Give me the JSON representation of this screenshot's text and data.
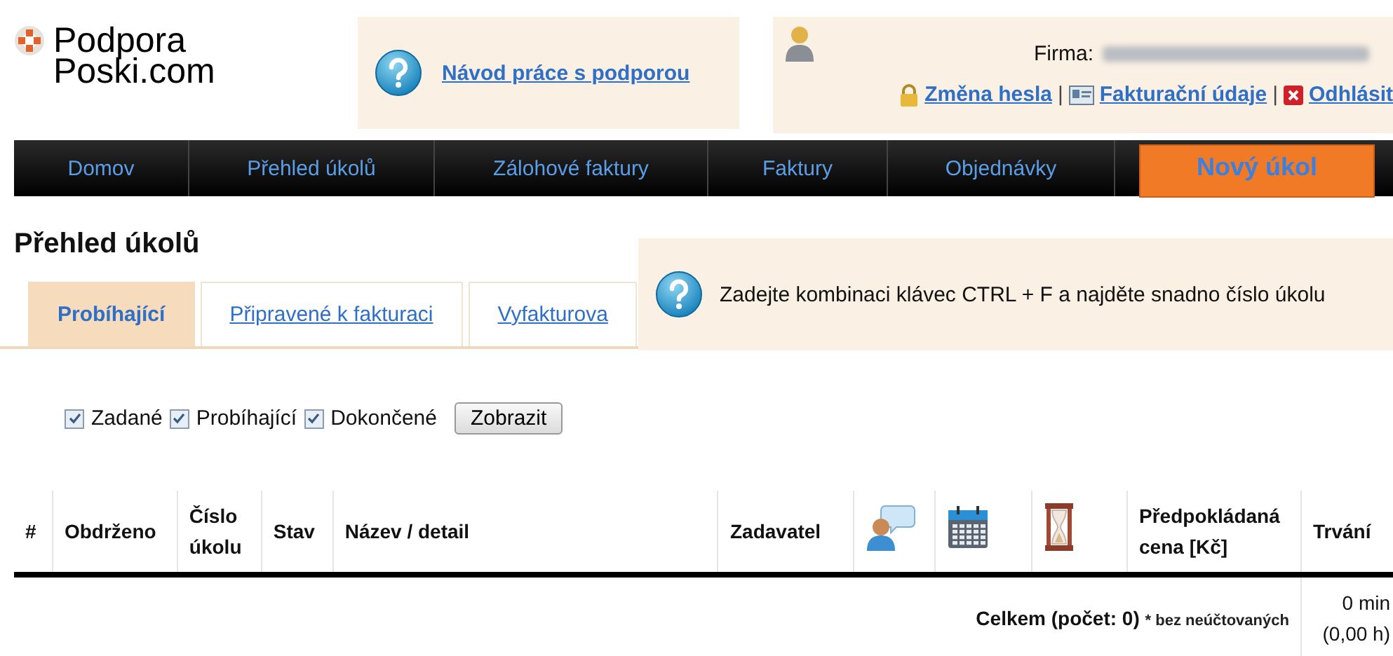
{
  "logo": {
    "line1": "Podpora",
    "line2": "Poski.com"
  },
  "help_box": {
    "link": "Návod práce s podporou"
  },
  "user_box": {
    "company_label": "Firma:",
    "links": [
      {
        "kind": "lock",
        "label": "Změna hesla"
      },
      {
        "kind": "card",
        "label": "Fakturační údaje"
      },
      {
        "kind": "close",
        "label": "Odhlásit"
      }
    ],
    "separator": "|"
  },
  "nav": [
    {
      "label": "Domov"
    },
    {
      "label": "Přehled úkolů"
    },
    {
      "label": "Zálohové faktury"
    },
    {
      "label": "Faktury"
    },
    {
      "label": "Objednávky"
    }
  ],
  "new_task_button": "Nový úkol",
  "page_title": "Přehled úkolů",
  "hint": "Zadejte kombinaci klávec CTRL + F a najděte snadno číslo úkolu",
  "tabs": [
    {
      "label": "Probíhající",
      "selected": true
    },
    {
      "label": "Připravené k fakturaci",
      "selected": false
    },
    {
      "label": "Vyfakturova",
      "selected": false
    }
  ],
  "filters": [
    {
      "label": "Zadané",
      "checked": true
    },
    {
      "label": "Probíhající",
      "checked": true
    },
    {
      "label": "Dokončené",
      "checked": true
    }
  ],
  "show_button": "Zobrazit",
  "table": {
    "columns": [
      {
        "kind": "text",
        "label": "#"
      },
      {
        "kind": "text",
        "label": "Obdrženo"
      },
      {
        "kind": "text",
        "label": "Číslo úkolu"
      },
      {
        "kind": "text",
        "label": "Stav"
      },
      {
        "kind": "text",
        "label": "Název / detail"
      },
      {
        "kind": "text",
        "label": "Zadavatel"
      },
      {
        "kind": "comment"
      },
      {
        "kind": "calendar"
      },
      {
        "kind": "hourglass"
      },
      {
        "kind": "text",
        "label": "Předpokládaná cena [Kč]"
      },
      {
        "kind": "text",
        "label": "Trvání"
      }
    ],
    "total": {
      "label": "Celkem (počet: 0)",
      "note": "* bez neúčtovaných",
      "minutes": "0 min",
      "hours": "(0,00 h)"
    }
  }
}
